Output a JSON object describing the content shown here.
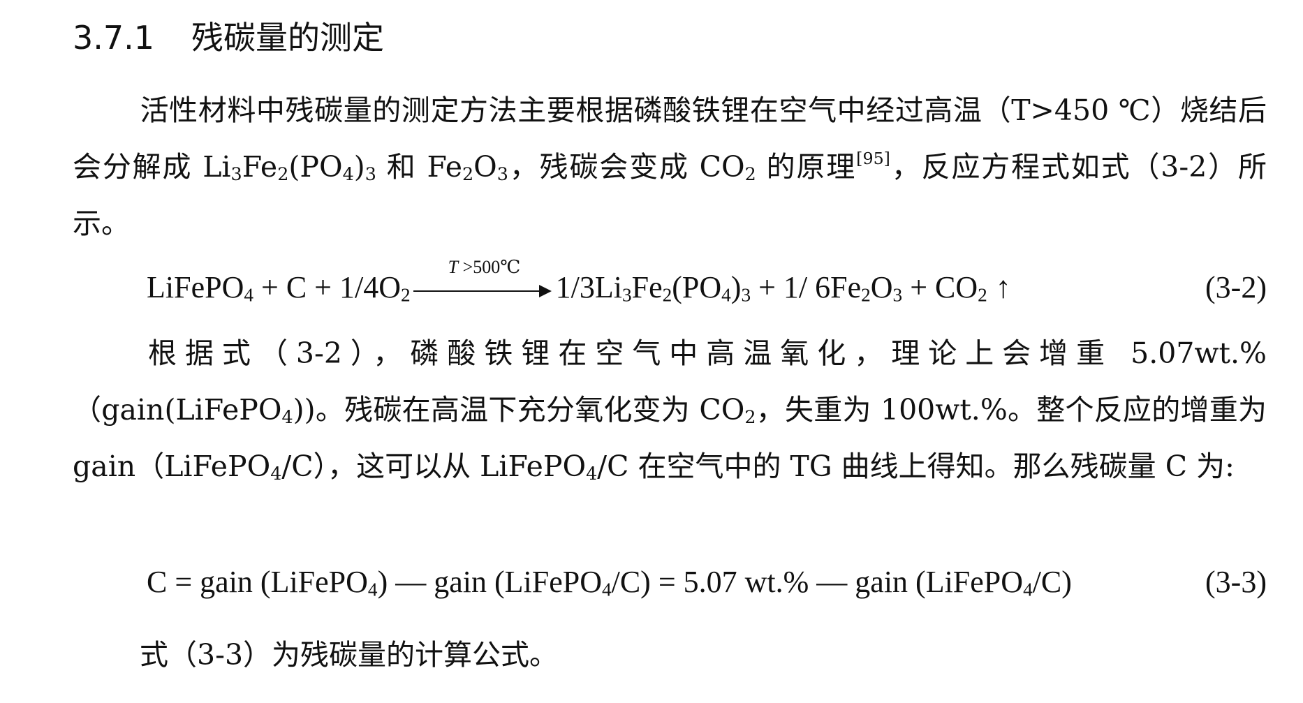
{
  "heading": {
    "number": "3.7.1",
    "title": "残碳量的测定"
  },
  "para1": {
    "s1": "活性材料中残碳量的测定方法主要根据磷酸铁锂在空气中经过高温（T>450 ℃）烧结后会分解成 Li",
    "s1_sub1": "3",
    "s2": "Fe",
    "s2_sub": "2",
    "s3": "(PO",
    "s3_sub": "4",
    "s4": ")",
    "s4_sub": "3",
    "s5": " 和 Fe",
    "s5_sub": "2",
    "s6": "O",
    "s6_sub": "3",
    "s7": "，残碳会变成 CO",
    "s7_sub": "2",
    "s8": " 的原理",
    "citation": "[95]",
    "s9": "，反应方程式如式（3-2）所示。"
  },
  "eq1": {
    "t1": "LiFePO",
    "t1_sub": "4",
    "t2": " + C + 1/4O",
    "t2_sub": "2",
    "cond_var": "T",
    "cond_rest": " >500℃",
    "t3": "1/3Li",
    "t3_sub": "3",
    "t4": "Fe",
    "t4_sub": "2",
    "t5": "(PO",
    "t5_sub": "4",
    "t6": ")",
    "t6_sub": "3",
    "t7": " + 1/ 6Fe",
    "t7_sub": "2",
    "t8": "O",
    "t8_sub": "3",
    "t9": " + CO",
    "t9_sub": "2",
    "up": "↑",
    "number": "(3-2)"
  },
  "para2": {
    "s1": "根据式（3-2），磷酸铁锂在空气中高温氧化，理论上会增重 5.07wt.%（gain(LiFePO",
    "s1_sub": "4",
    "s2": "))。残碳在高温下充分氧化变为 CO",
    "s2_sub": "2",
    "s3": "，失重为 100wt.%。整个反应的增重为 gain（LiFePO",
    "s3_sub": "4",
    "s4": "/C），这可以从 LiFePO",
    "s4_sub": "4",
    "s5": "/C 在空气中的 TG 曲线上得知。那么残碳量 C 为:"
  },
  "eq2": {
    "t1": "C = gain (LiFePO",
    "t1_sub": "4",
    "t2": ") — gain (LiFePO",
    "t2_sub": "4",
    "t3": "/C) = 5.07 wt.% — gain (LiFePO",
    "t3_sub": "4",
    "t4": "/C)",
    "number": "(3-3)"
  },
  "final": {
    "text": "式（3-3）为残碳量的计算公式。"
  }
}
